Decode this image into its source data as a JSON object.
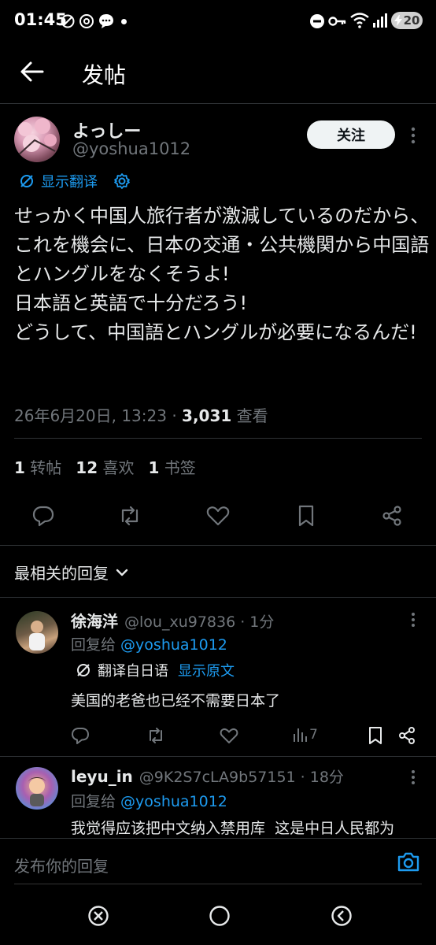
{
  "status_bar": {
    "time": "01:45",
    "battery_level": "20"
  },
  "header": {
    "title": "发帖"
  },
  "tweet": {
    "display_name": "よっしー",
    "handle": "@yoshua1012",
    "follow_label": "关注",
    "translate_label": "显示翻译",
    "text": "せっかく中国人旅行者が激減しているのだから、これを機会に、日本の交通・公共機関から中国語とハングルをなくそうよ!\n日本語と英語で十分だろう!\nどうして、中国語とハングルが必要になるんだ!",
    "timestamp": "26年6月20日, 13:23 · ",
    "views_count": "3,031",
    "views_label": " 查看",
    "reposts_count": "1",
    "reposts_label": "转帖",
    "likes_count": "12",
    "likes_label": "喜欢",
    "bookmarks_count": "1",
    "bookmarks_label": "书签"
  },
  "sort": {
    "label": "最相关的回复"
  },
  "replies": [
    {
      "display_name": "徐海洋",
      "handle": "@lou_xu97836 · 1分",
      "reply_to_prefix": "回复给 ",
      "reply_to_handle": "@yoshua1012",
      "translated_from": "翻译自日语",
      "show_original": "显示原文",
      "text": "美国的老爸也已经不需要日本了",
      "views": "7"
    },
    {
      "display_name": "leyu_in",
      "handle": "@9K2S7cLA9b57151 · 18分",
      "reply_to_prefix": "回复给 ",
      "reply_to_handle": "@yoshua1012",
      "text": "我觉得应该把中文纳入禁用库  这是中日人民都为"
    }
  ],
  "compose": {
    "placeholder": "发布你的回复"
  },
  "colors": {
    "background": "#000000",
    "text": "#e7e9ea",
    "muted": "#71767b",
    "accent": "#1d9bf0",
    "divider": "#2f3336"
  }
}
